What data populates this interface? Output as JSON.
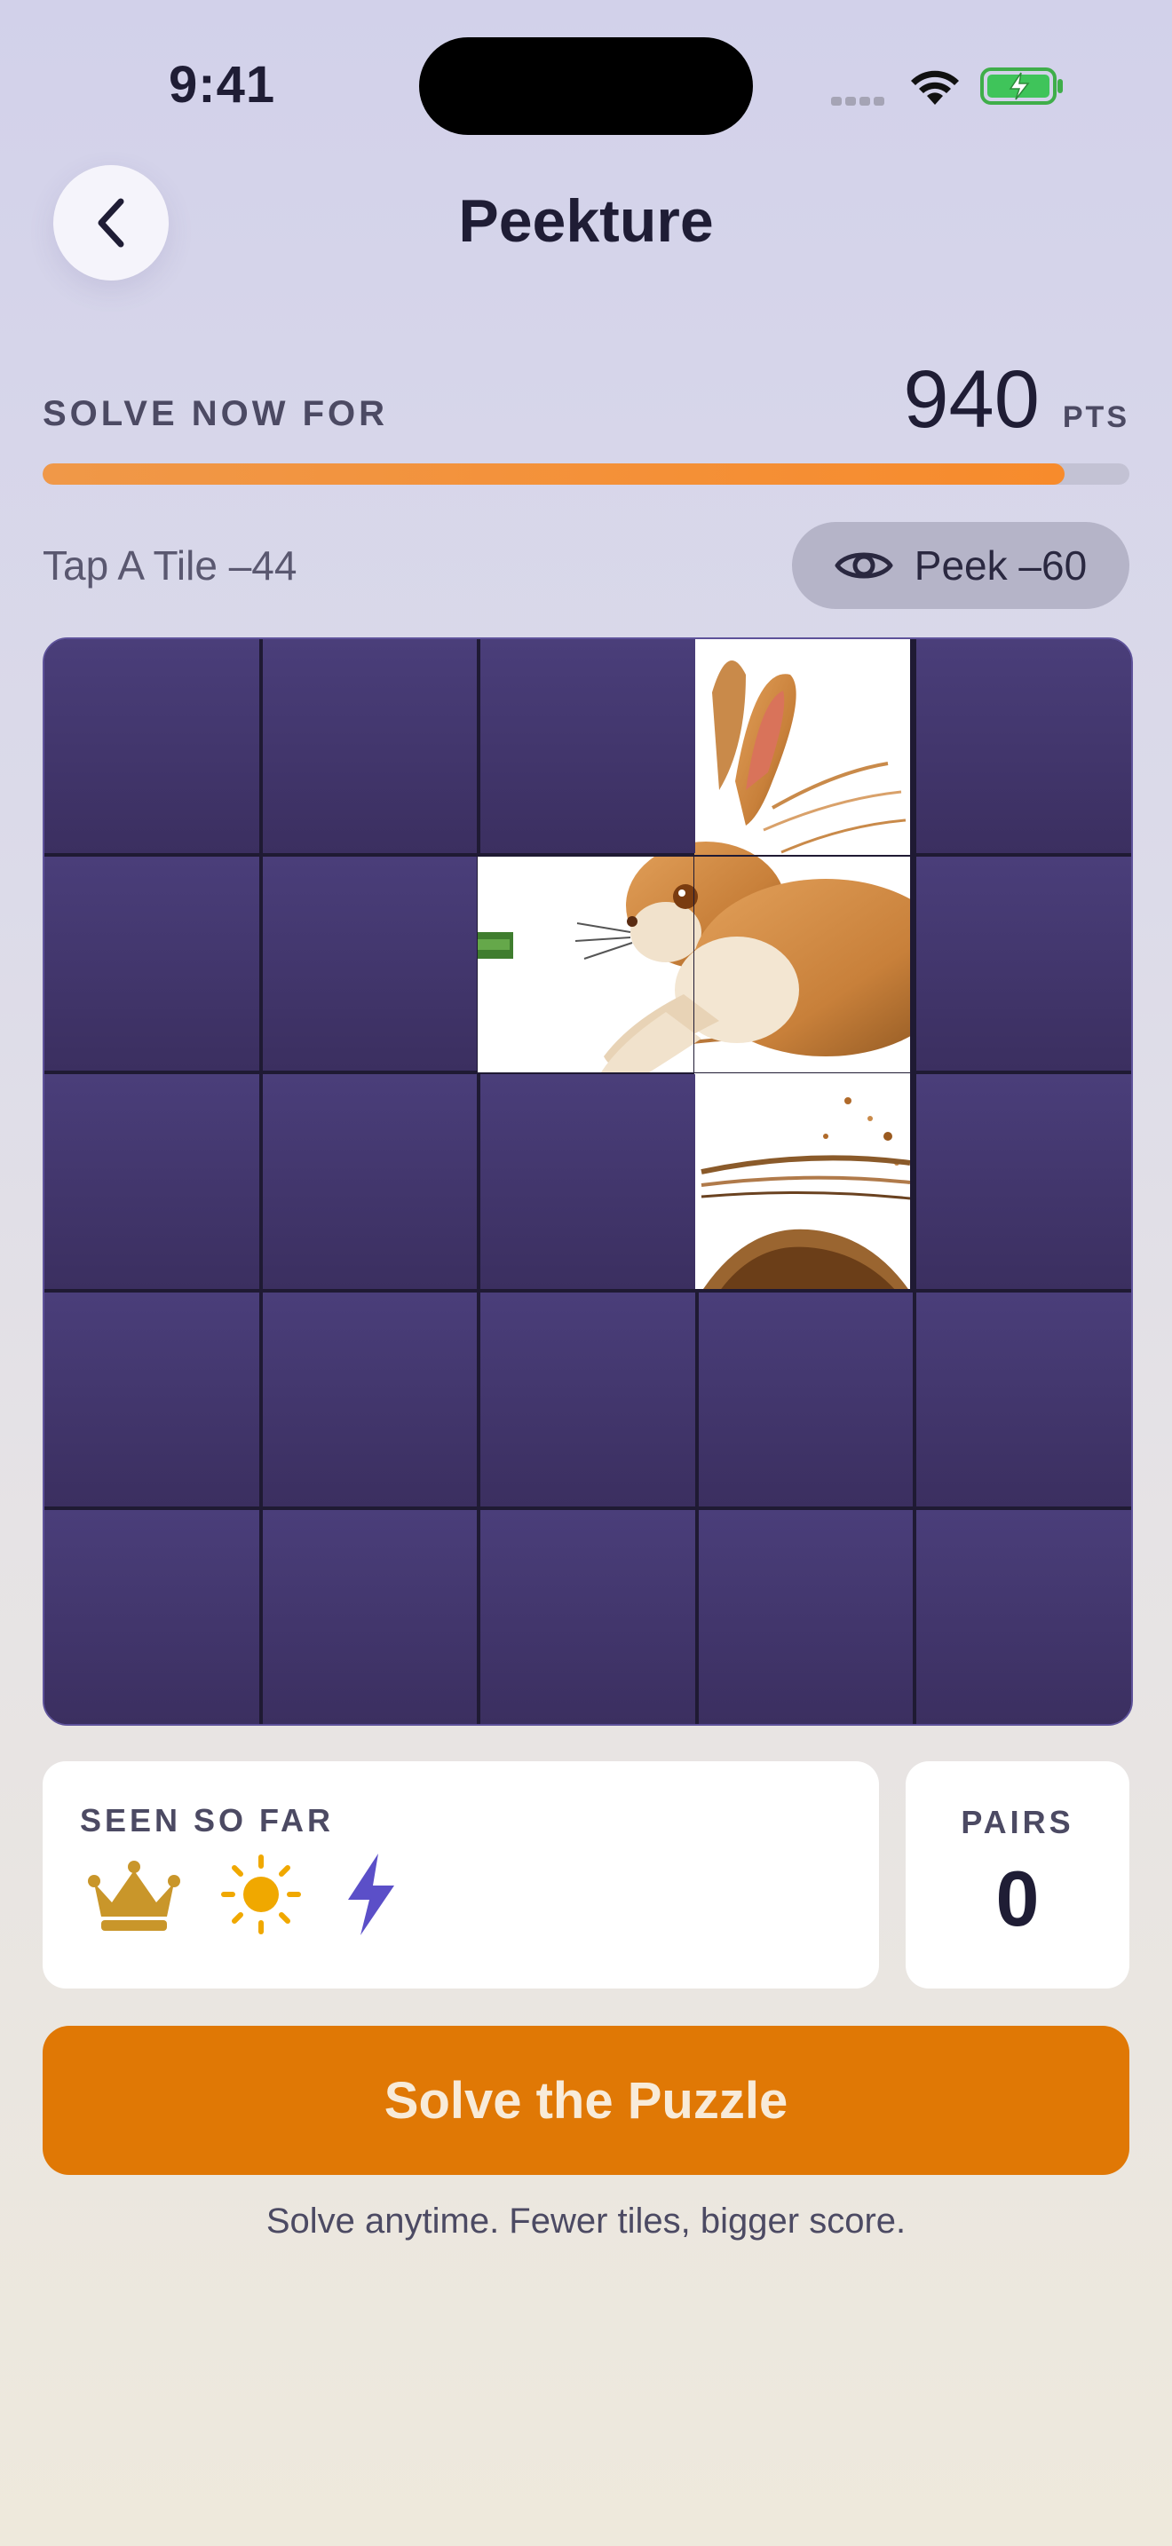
{
  "status_bar": {
    "time": "9:41"
  },
  "header": {
    "title": "Peekture",
    "back_icon": "chevron-left-icon"
  },
  "score": {
    "label": "SOLVE NOW FOR",
    "points": "940",
    "unit": "PTS",
    "progress_fraction": 0.94
  },
  "actions": {
    "tap_label": "Tap A Tile –44",
    "peek_label": "Peek –60",
    "peek_icon": "eye-icon"
  },
  "board": {
    "rows": 5,
    "cols": 5,
    "revealed_tiles": [
      [
        0,
        3
      ],
      [
        1,
        2
      ],
      [
        1,
        3
      ],
      [
        2,
        3
      ]
    ],
    "image_subject": "rabbit"
  },
  "seen": {
    "label": "SEEN SO FAR",
    "icons": [
      "crown-icon",
      "sun-icon",
      "lightning-icon"
    ]
  },
  "pairs": {
    "label": "PAIRS",
    "value": "0"
  },
  "solve_button": {
    "label": "Solve the Puzzle"
  },
  "footer_hint": "Solve anytime. Fewer tiles, bigger score.",
  "colors": {
    "accent_orange": "#e07805",
    "progress_orange": "#f78b2c",
    "tile_purple": "#45397a",
    "crown_gold": "#c9962a",
    "sun_yellow": "#f0a800",
    "lightning_purple": "#5b4fc8"
  }
}
